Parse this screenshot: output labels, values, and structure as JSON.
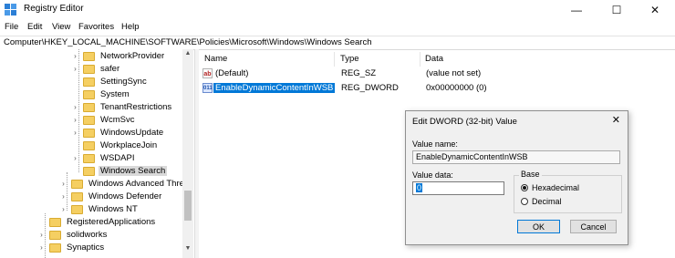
{
  "window": {
    "title": "Registry Editor",
    "minimize_glyph": "—",
    "maximize_glyph": "☐",
    "close_glyph": "✕"
  },
  "menu": [
    "File",
    "Edit",
    "View",
    "Favorites",
    "Help"
  ],
  "address": "Computer\\HKEY_LOCAL_MACHINE\\SOFTWARE\\Policies\\Microsoft\\Windows\\Windows Search",
  "tree": [
    {
      "label": "NetworkProvider",
      "expandable": true
    },
    {
      "label": "safer",
      "expandable": true
    },
    {
      "label": "SettingSync",
      "expandable": false
    },
    {
      "label": "System",
      "expandable": false
    },
    {
      "label": "TenantRestrictions",
      "expandable": true
    },
    {
      "label": "WcmSvc",
      "expandable": true
    },
    {
      "label": "WindowsUpdate",
      "expandable": true
    },
    {
      "label": "WorkplaceJoin",
      "expandable": false
    },
    {
      "label": "WSDAPI",
      "expandable": true
    },
    {
      "label": "Windows Search",
      "expandable": false,
      "selected": true
    },
    {
      "label": "Windows Advanced Threa",
      "expandable": true
    },
    {
      "label": "Windows Defender",
      "expandable": true
    },
    {
      "label": "Windows NT",
      "expandable": true
    },
    {
      "label": "RegisteredApplications",
      "expandable": false
    },
    {
      "label": "solidworks",
      "expandable": true
    },
    {
      "label": "Synaptics",
      "expandable": true
    }
  ],
  "columns": {
    "name": "Name",
    "type": "Type",
    "data": "Data"
  },
  "values": [
    {
      "name": "(Default)",
      "type": "REG_SZ",
      "data": "(value not set)",
      "icon": "ab"
    },
    {
      "name": "EnableDynamicContentInWSB",
      "type": "REG_DWORD",
      "data": "0x00000000 (0)",
      "icon": "011"
    }
  ],
  "dialog": {
    "title": "Edit DWORD (32-bit) Value",
    "close_glyph": "✕",
    "value_name_label": "Value name:",
    "value_name": "EnableDynamicContentInWSB",
    "value_data_label": "Value data:",
    "value_data": "0",
    "base_label": "Base",
    "hex_label": "Hexadecimal",
    "dec_label": "Decimal",
    "selected_base": "Hexadecimal",
    "ok_label": "OK",
    "cancel_label": "Cancel"
  },
  "colors": {
    "selection": "#0078d7",
    "folder": "#f5cf62"
  }
}
